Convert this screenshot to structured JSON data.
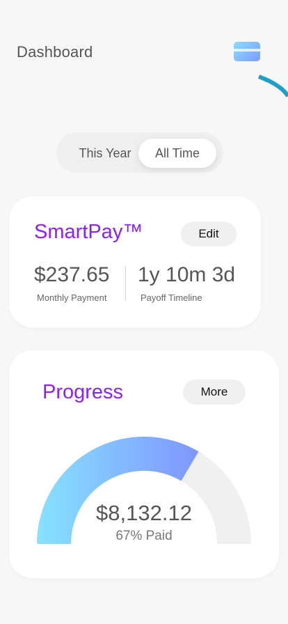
{
  "header": {
    "title": "Dashboard",
    "card_icon": "credit-card-icon"
  },
  "toggle": {
    "options": [
      "This Year",
      "All Time"
    ],
    "selected": "All Time"
  },
  "smartpay": {
    "title": "SmartPay™",
    "edit_label": "Edit",
    "monthly_payment": "$237.65",
    "monthly_payment_label": "Monthly Payment",
    "payoff_timeline": "1y 10m 3d",
    "payoff_timeline_label": "Payoff Timeline"
  },
  "progress": {
    "title": "Progress",
    "more_label": "More",
    "amount": "$8,132.12",
    "percent_label": "67% Paid",
    "percent_paid": 0.67
  },
  "colors": {
    "accent": "#8b22f0",
    "gauge_start": "#86e2ff",
    "gauge_end": "#7f96ff",
    "gauge_track": "#f0f0f0",
    "corner_arc": "#1e9ec9"
  }
}
